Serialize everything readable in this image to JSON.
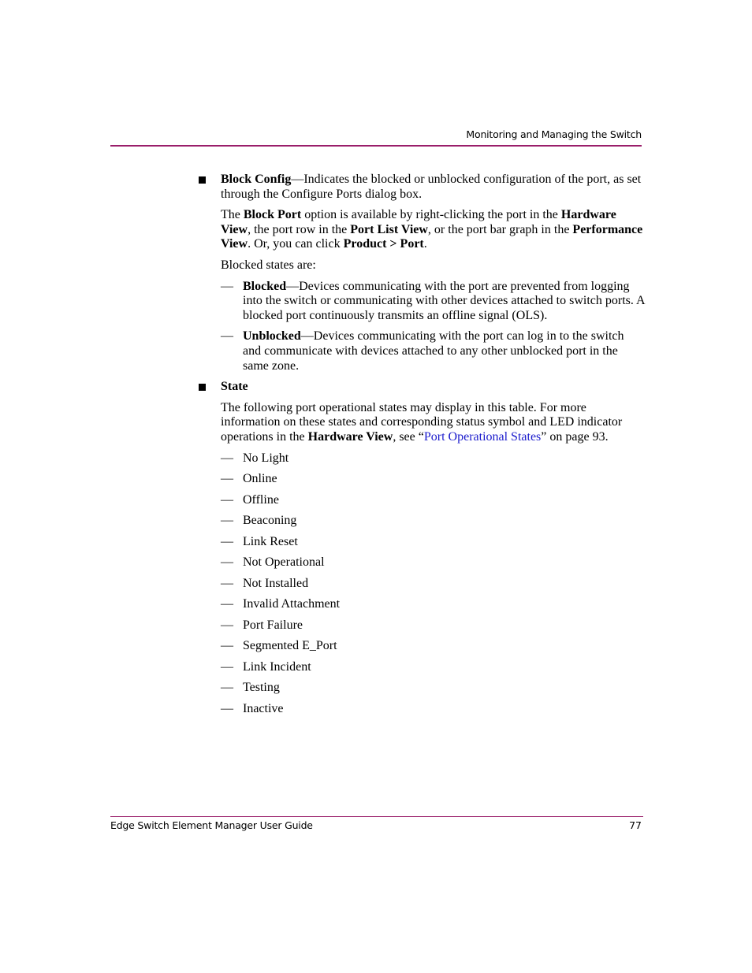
{
  "header": {
    "running_title": "Monitoring and Managing the Switch"
  },
  "footer": {
    "book_title": "Edge Switch Element Manager User Guide",
    "page_number": "77"
  },
  "block_config": {
    "term": "Block Config",
    "description": "—Indicates the blocked or unblocked configuration of the port, as set through the Configure Ports dialog box.",
    "para": {
      "t1": "The ",
      "b1": "Block Port",
      "t2": " option is available by right-clicking the port in the ",
      "b2": "Hardware View",
      "t3": ", the port row in the ",
      "b3": "Port List View",
      "t4": ", or the port bar graph in the ",
      "b4": "Performance View",
      "t5": ". Or, you can click ",
      "b5": "Product > Port",
      "t6": "."
    },
    "states_intro": "Blocked states are:",
    "states": [
      {
        "term": "Blocked",
        "text": "—Devices communicating with the port are prevented from logging into the switch or communicating with other devices attached to switch ports. A blocked port continuously transmits an offline signal (OLS)."
      },
      {
        "term": "Unblocked",
        "text": "—Devices communicating with the port can log in to the switch and communicate with devices attached to any other unblocked port in the same zone."
      }
    ]
  },
  "state": {
    "term": "State",
    "para": {
      "t1": "The following port operational states may display in this table. For more information on these states and corresponding status symbol and LED indicator operations in the ",
      "b1": "Hardware View",
      "t2": ", see “",
      "link": "Port Operational States",
      "t3": "” on page 93."
    },
    "items": [
      "No Light",
      "Online",
      "Offline",
      "Beaconing",
      "Link Reset",
      "Not Operational",
      "Not Installed",
      "Invalid Attachment",
      "Port Failure",
      "Segmented E_Port",
      "Link Incident",
      "Testing",
      "Inactive"
    ]
  },
  "glyphs": {
    "dash": "—"
  },
  "colors": {
    "rule": "#9a1e6a",
    "link": "#1a1acc"
  }
}
